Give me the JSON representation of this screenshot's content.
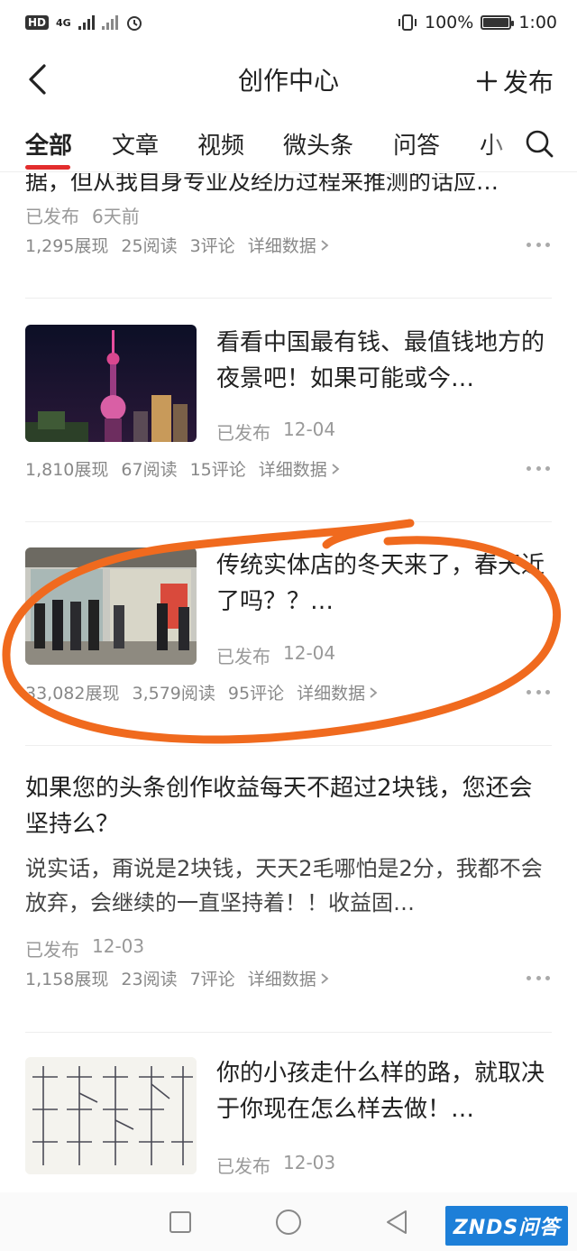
{
  "status_bar": {
    "hd_label": "HD",
    "network": "4G",
    "battery_percent": "100%",
    "battery_level": 1.0,
    "time": "1:00"
  },
  "header": {
    "title": "创作中心",
    "publish_label": "发布"
  },
  "tabs": [
    {
      "label": "全部",
      "active": true
    },
    {
      "label": "文章",
      "active": false
    },
    {
      "label": "视频",
      "active": false
    },
    {
      "label": "微头条",
      "active": false
    },
    {
      "label": "问答",
      "active": false
    },
    {
      "label": "小",
      "active": false
    }
  ],
  "feed": {
    "clipped_text": "据，但从我自身专业及经历过程来推测的话应…",
    "items": [
      {
        "status": "已发布",
        "time": "6天前",
        "views": "1,295展现",
        "reads": "25阅读",
        "comments": "3评论",
        "detail": "详细数据"
      },
      {
        "title": "看看中国最有钱、最值钱地方的夜景吧！如果可能或今…",
        "status": "已发布",
        "time": "12-04",
        "views": "1,810展现",
        "reads": "67阅读",
        "comments": "15评论",
        "detail": "详细数据",
        "thumb_icon": "night-city-tower-image"
      },
      {
        "title": "传统实体店的冬天来了，春天近了吗？？…",
        "status": "已发布",
        "time": "12-04",
        "views": "33,082展现",
        "reads": "3,579阅读",
        "comments": "95评论",
        "detail": "详细数据",
        "thumb_icon": "storefront-people-image"
      },
      {
        "title": "如果您的头条创作收益每天不超过2块钱，您还会坚持么？",
        "abstract": "说实话，甭说是2块钱，天天2毛哪怕是2分，我都不会放弃，会继续的一直坚持着！！收益固…",
        "status": "已发布",
        "time": "12-03",
        "views": "1,158展现",
        "reads": "23阅读",
        "comments": "7评论",
        "detail": "详细数据"
      },
      {
        "title": "你的小孩走什么样的路，就取决于你现在怎么样去做！…",
        "status": "已发布",
        "time": "12-03",
        "thumb_icon": "handwritten-chart-image"
      }
    ]
  },
  "watermark": "ZNDS问答",
  "colors": {
    "accent": "#e32d2d",
    "annotation": "#f06a1e",
    "watermark_bg": "#1d7fd8"
  }
}
